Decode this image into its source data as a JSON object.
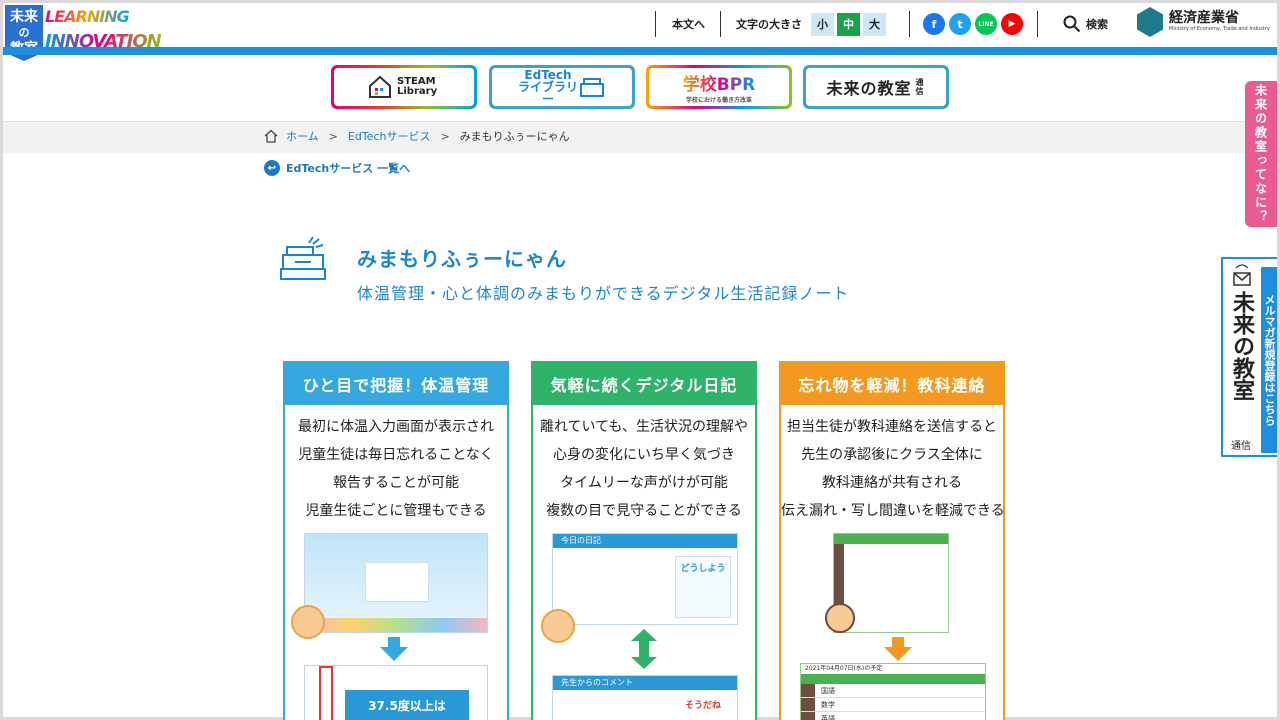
{
  "logo": {
    "kanji": [
      "未来",
      "の",
      "教室"
    ],
    "word1": "LEARNING",
    "word2": "INNOVATION"
  },
  "header": {
    "skip_label": "本文へ",
    "text_size_label": "文字の大きさ",
    "size_small": "小",
    "size_medium": "中",
    "size_large": "大",
    "search_label": "検索",
    "meti_name": "経済産業省",
    "meti_sub": "Ministry of Economy, Trade and Industry"
  },
  "sns": [
    {
      "name": "facebook",
      "glyph": "f",
      "color": "#1877f2"
    },
    {
      "name": "twitter",
      "glyph": "t",
      "color": "#1da1f2"
    },
    {
      "name": "line",
      "glyph": "LINE",
      "color": "#06c755"
    },
    {
      "name": "youtube",
      "glyph": "▶",
      "color": "#ff0000"
    }
  ],
  "banners": [
    {
      "label": "STEAM Library"
    },
    {
      "label": "EdTech ライブラリー"
    },
    {
      "label": "学校BPR"
    },
    {
      "label": "未来の教室"
    }
  ],
  "banner_extras": {
    "bpr_sub": "学校における働き方改革",
    "mirai_sub": "通信"
  },
  "breadcrumb": {
    "home": "ホーム",
    "sep": ">",
    "category": "EdTechサービス",
    "current": "みまもりふぅーにゃん"
  },
  "back_link": "EdTechサービス 一覧へ",
  "product": {
    "title": "みまもりふぅーにゃん",
    "subtitle": "体温管理・心と体調のみまもりができるデジタル生活記録ノート"
  },
  "features": [
    {
      "heading": "ひと目で把握！体温管理",
      "color": "#36a8e0",
      "lines": [
        "最初に体温入力画面が表示され",
        "児童生徒は毎日忘れることなく",
        "報告することが可能",
        "児童生徒ごとに管理もできる"
      ],
      "callout": "37.5度以上は"
    },
    {
      "heading": "気軽に続くデジタル日記",
      "color": "#2db36a",
      "lines": [
        "離れていても、生活状況の理解や",
        "心身の変化にいち早く気づき",
        "タイムリーな声がけが可能",
        "複数の目で見守ることができる"
      ],
      "shot_top_label": "今日の日記",
      "shot_bottom_label": "先生からのコメント",
      "bubble1": "どうしよう",
      "bubble2": "そうだね"
    },
    {
      "heading": "忘れ物を軽減！教科連絡",
      "color": "#f29a1f",
      "lines": [
        "担当生徒が教科連絡を送信すると",
        "先生の承認後にクラス全体に",
        "教科連絡が共有される",
        "伝え漏れ・写し間違いを軽減できる"
      ],
      "schedule_label": "2021年04月07日(水)の予定",
      "subjects": [
        "国語",
        "数学",
        "英語"
      ]
    }
  ],
  "side": {
    "pink_label": "未来の教室ってなに？",
    "mail_big": "未来の教室",
    "mail_small": "通信",
    "mail_strip": "メルマガ新規登録はこちら"
  }
}
